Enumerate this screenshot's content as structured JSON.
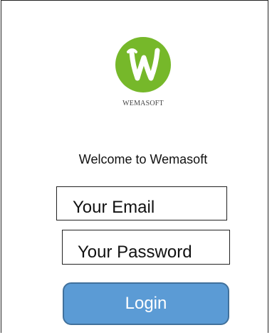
{
  "app": {
    "brand_name": "WEMASOFT",
    "logo_letter": "W",
    "logo_color": "#76b82a"
  },
  "main": {
    "welcome_text": "Welcome to Wemasoft"
  },
  "form": {
    "email": {
      "value": "",
      "placeholder": "Your Email"
    },
    "password": {
      "value": "",
      "placeholder": "Your Password"
    },
    "login_button_label": "Login",
    "login_button_color": "#5b9bd5"
  }
}
